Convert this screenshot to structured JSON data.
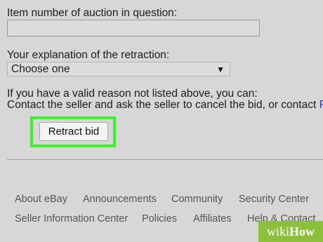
{
  "form": {
    "item_number_label": "Item number of auction in question:",
    "item_number_value": "",
    "explanation_label": "Your explanation of the retraction:",
    "explanation_selected": "Choose one",
    "caret": "▼",
    "reason_text": "If you have a valid reason not listed above, you can:",
    "contact_text": "Contact the seller and ask the seller to cancel the bid, or contact ",
    "contact_link_fragment": "R",
    "retract_button_label": "Retract bid",
    "highlight_color": "#3cf02b"
  },
  "footer": {
    "row1": [
      "About eBay",
      "Announcements",
      "Community",
      "Security Center"
    ],
    "row2": [
      "Seller Information Center",
      "Policies",
      "Affiliates",
      "Help & Contact"
    ]
  },
  "watermark": {
    "part1": "wiki",
    "part2": "How"
  }
}
